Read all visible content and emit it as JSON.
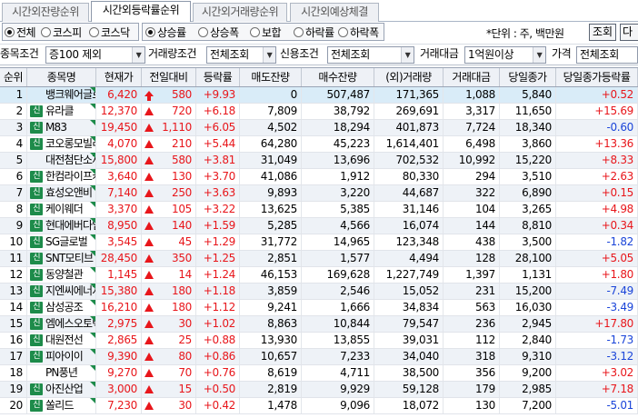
{
  "tabs": [
    "시간외잔량순위",
    "시간외등락률순위",
    "시간외거래량순위",
    "시간외예상체결"
  ],
  "active_tab": 1,
  "market_radios": [
    {
      "label": "전체",
      "checked": true
    },
    {
      "label": "코스피",
      "checked": false
    },
    {
      "label": "코스닥",
      "checked": false
    }
  ],
  "type_radios": [
    {
      "label": "상승률",
      "checked": true
    },
    {
      "label": "상승폭",
      "checked": false
    },
    {
      "label": "보합",
      "checked": false
    },
    {
      "label": "하락률",
      "checked": false
    },
    {
      "label": "하락폭",
      "checked": false
    }
  ],
  "unit_text": "*단위 : 주, 백만원",
  "query_button": "조회",
  "next_button": "다",
  "filters": {
    "item_cond_label": "종목조건",
    "item_cond_value": "증100 제외",
    "volume_cond_label": "거래량조건",
    "volume_cond_value": "전체조회",
    "credit_cond_label": "신용조건",
    "credit_cond_value": "전체조회",
    "amount_label": "거래대금",
    "amount_value": "1억원이상",
    "price_label": "가격",
    "price_value": "전체조회"
  },
  "columns": [
    "순위",
    "종목명",
    "현재가",
    "전일대비",
    "등락률",
    "매도잔량",
    "매수잔량",
    "(외)거래량",
    "거래대금",
    "당일종가",
    "당일종가등락률"
  ],
  "rows": [
    {
      "rank": "1",
      "credit": false,
      "name": "뱅크웨어글로",
      "price": "6,420",
      "dir": "upper",
      "change": "580",
      "rate": "+9.93",
      "sell": "0",
      "buy": "507,487",
      "volume": "171,365",
      "amount": "1,088",
      "close": "5,840",
      "close_rate": "+0.52",
      "close_up": true
    },
    {
      "rank": "2",
      "credit": true,
      "name": "유라클",
      "price": "12,370",
      "dir": "up",
      "change": "720",
      "rate": "+6.18",
      "sell": "7,809",
      "buy": "38,792",
      "volume": "269,691",
      "amount": "3,317",
      "close": "11,650",
      "close_rate": "+15.69",
      "close_up": true
    },
    {
      "rank": "3",
      "credit": true,
      "name": "M83",
      "price": "19,450",
      "dir": "up",
      "change": "1,110",
      "rate": "+6.05",
      "sell": "4,502",
      "buy": "18,294",
      "volume": "401,873",
      "amount": "7,724",
      "close": "18,340",
      "close_rate": "-0.60",
      "close_up": false
    },
    {
      "rank": "4",
      "credit": true,
      "name": "코오롱모빌리",
      "price": "4,070",
      "dir": "up",
      "change": "210",
      "rate": "+5.44",
      "sell": "64,280",
      "buy": "45,223",
      "volume": "1,614,401",
      "amount": "6,498",
      "close": "3,860",
      "close_rate": "+13.36",
      "close_up": true
    },
    {
      "rank": "5",
      "credit": false,
      "name": "대전첨단소재",
      "price": "15,800",
      "dir": "up",
      "change": "580",
      "rate": "+3.81",
      "sell": "31,049",
      "buy": "13,696",
      "volume": "702,532",
      "amount": "10,992",
      "close": "15,220",
      "close_rate": "+8.33",
      "close_up": true
    },
    {
      "rank": "6",
      "credit": true,
      "name": "한컴라이프케",
      "price": "3,640",
      "dir": "up",
      "change": "130",
      "rate": "+3.70",
      "sell": "41,086",
      "buy": "1,912",
      "volume": "80,330",
      "amount": "294",
      "close": "3,510",
      "close_rate": "+2.63",
      "close_up": true
    },
    {
      "rank": "7",
      "credit": true,
      "name": "효성오앤비",
      "price": "7,140",
      "dir": "up",
      "change": "250",
      "rate": "+3.63",
      "sell": "9,893",
      "buy": "3,220",
      "volume": "44,687",
      "amount": "322",
      "close": "6,890",
      "close_rate": "+0.15",
      "close_up": true
    },
    {
      "rank": "8",
      "credit": true,
      "name": "케이웨더",
      "price": "3,370",
      "dir": "up",
      "change": "105",
      "rate": "+3.22",
      "sell": "13,625",
      "buy": "5,385",
      "volume": "31,146",
      "amount": "104",
      "close": "3,265",
      "close_rate": "+4.98",
      "close_up": true
    },
    {
      "rank": "9",
      "credit": true,
      "name": "현대에버다임",
      "price": "8,950",
      "dir": "up",
      "change": "140",
      "rate": "+1.59",
      "sell": "5,285",
      "buy": "4,566",
      "volume": "16,074",
      "amount": "144",
      "close": "8,810",
      "close_rate": "+0.34",
      "close_up": true
    },
    {
      "rank": "10",
      "credit": true,
      "name": "SG글로벌",
      "price": "3,545",
      "dir": "up",
      "change": "45",
      "rate": "+1.29",
      "sell": "31,772",
      "buy": "14,965",
      "volume": "123,348",
      "amount": "438",
      "close": "3,500",
      "close_rate": "-1.82",
      "close_up": false
    },
    {
      "rank": "11",
      "credit": true,
      "name": "SNT모티브",
      "price": "28,450",
      "dir": "up",
      "change": "350",
      "rate": "+1.25",
      "sell": "2,851",
      "buy": "1,577",
      "volume": "4,494",
      "amount": "128",
      "close": "28,100",
      "close_rate": "+5.05",
      "close_up": true
    },
    {
      "rank": "12",
      "credit": true,
      "name": "동양철관",
      "price": "1,145",
      "dir": "up",
      "change": "14",
      "rate": "+1.24",
      "sell": "46,153",
      "buy": "169,628",
      "volume": "1,227,749",
      "amount": "1,397",
      "close": "1,131",
      "close_rate": "+1.80",
      "close_up": true
    },
    {
      "rank": "13",
      "credit": true,
      "name": "지엔씨에너지",
      "price": "15,380",
      "dir": "up",
      "change": "180",
      "rate": "+1.18",
      "sell": "3,859",
      "buy": "2,546",
      "volume": "15,052",
      "amount": "231",
      "close": "15,200",
      "close_rate": "-7.49",
      "close_up": false
    },
    {
      "rank": "14",
      "credit": true,
      "name": "삼성공조",
      "price": "16,210",
      "dir": "up",
      "change": "180",
      "rate": "+1.12",
      "sell": "9,241",
      "buy": "1,666",
      "volume": "34,834",
      "amount": "563",
      "close": "16,030",
      "close_rate": "-3.49",
      "close_up": false
    },
    {
      "rank": "15",
      "credit": true,
      "name": "엠에스오토텍",
      "price": "2,975",
      "dir": "up",
      "change": "30",
      "rate": "+1.02",
      "sell": "8,863",
      "buy": "10,844",
      "volume": "79,547",
      "amount": "236",
      "close": "2,945",
      "close_rate": "+17.80",
      "close_up": true
    },
    {
      "rank": "16",
      "credit": true,
      "name": "대원전선",
      "price": "2,865",
      "dir": "up",
      "change": "25",
      "rate": "+0.88",
      "sell": "13,930",
      "buy": "13,855",
      "volume": "39,031",
      "amount": "112",
      "close": "2,840",
      "close_rate": "-1.73",
      "close_up": false
    },
    {
      "rank": "17",
      "credit": true,
      "name": "피아이이",
      "price": "9,390",
      "dir": "up",
      "change": "80",
      "rate": "+0.86",
      "sell": "10,657",
      "buy": "7,233",
      "volume": "34,040",
      "amount": "318",
      "close": "9,310",
      "close_rate": "-3.12",
      "close_up": false
    },
    {
      "rank": "18",
      "credit": false,
      "name": "PN풍년",
      "price": "9,270",
      "dir": "up",
      "change": "70",
      "rate": "+0.76",
      "sell": "8,619",
      "buy": "4,711",
      "volume": "38,500",
      "amount": "356",
      "close": "9,200",
      "close_rate": "+3.02",
      "close_up": true
    },
    {
      "rank": "19",
      "credit": true,
      "name": "아진산업",
      "price": "3,000",
      "dir": "up",
      "change": "15",
      "rate": "+0.50",
      "sell": "2,819",
      "buy": "9,929",
      "volume": "59,128",
      "amount": "179",
      "close": "2,985",
      "close_rate": "+7.18",
      "close_up": true
    },
    {
      "rank": "20",
      "credit": true,
      "name": "쏠리드",
      "price": "7,230",
      "dir": "up",
      "change": "30",
      "rate": "+0.42",
      "sell": "1,478",
      "buy": "9,096",
      "volume": "18,072",
      "amount": "130",
      "close": "7,200",
      "close_rate": "-5.01",
      "close_up": false
    }
  ],
  "credit_badge": "신",
  "colors": {
    "up": "#e8161b",
    "down": "#1b45d9",
    "badge": "#1d8b4a",
    "selected_row": "#d9ecf8"
  }
}
